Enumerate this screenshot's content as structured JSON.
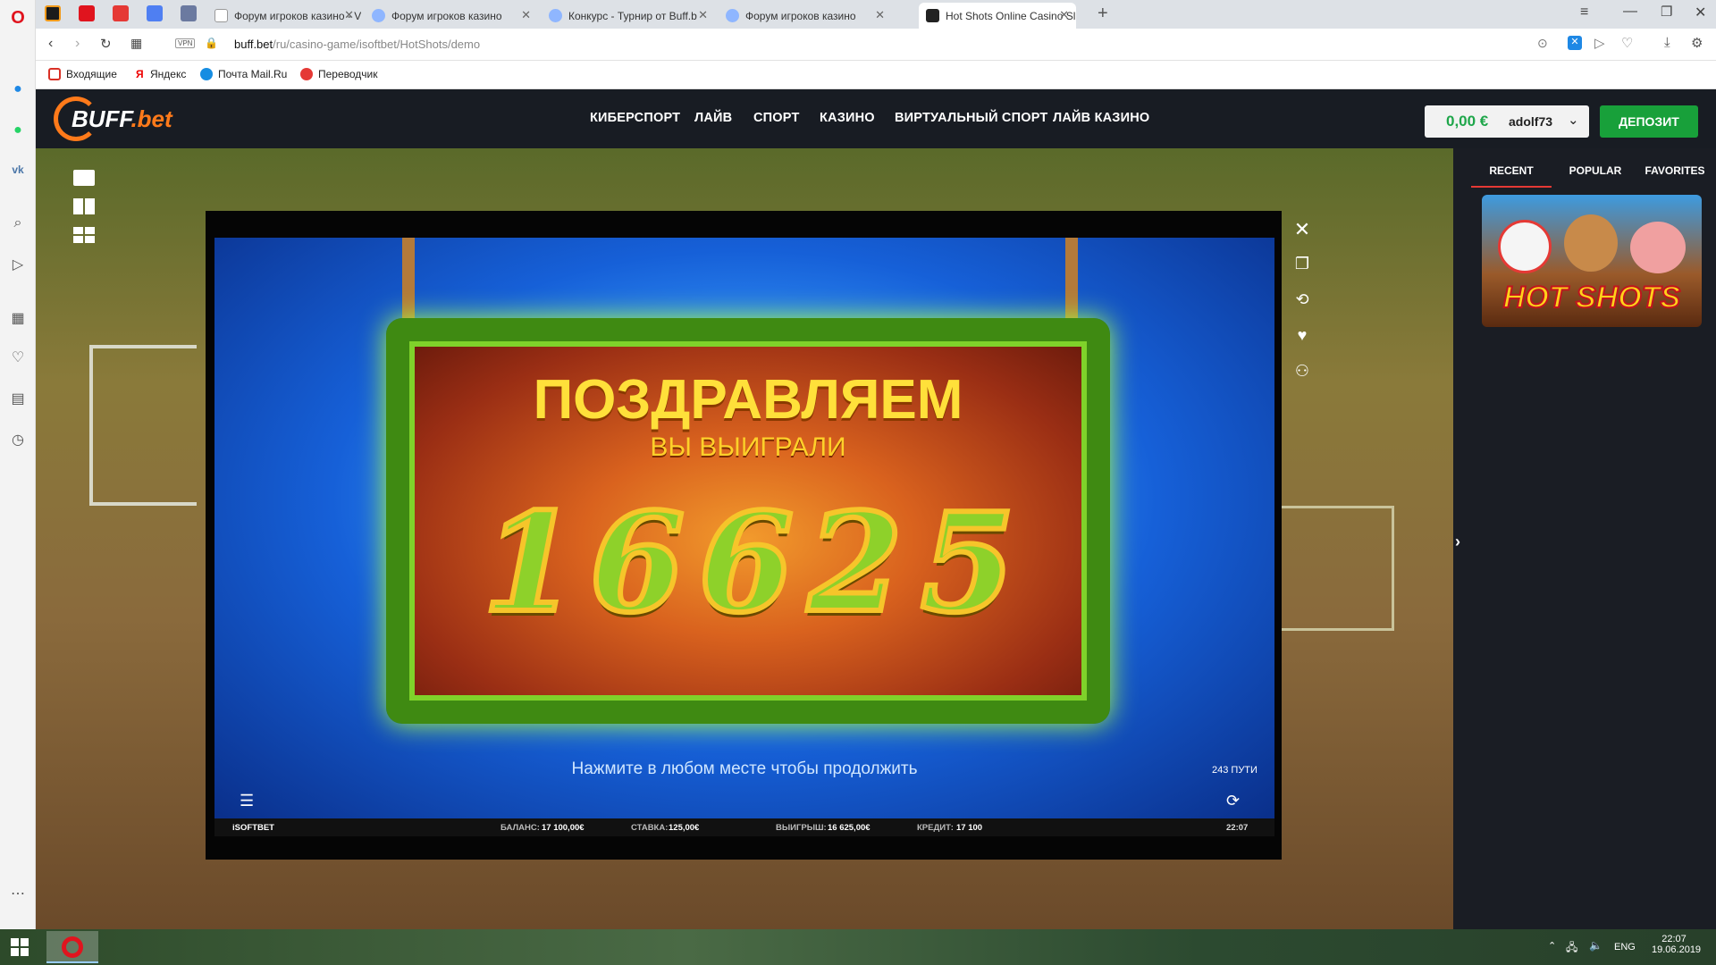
{
  "browser": {
    "tabs": [
      {
        "title": "Форум игроков казино - V"
      },
      {
        "title": "Форум игроков казино"
      },
      {
        "title": "Конкурс - Турнир от Buff.b"
      },
      {
        "title": "Форум игроков казино"
      },
      {
        "title": "Hot Shots Online Casino Sl"
      }
    ],
    "url_host": "buff.bet",
    "url_path": "/ru/casino-game/isoftbet/HotShots/demo",
    "vpn_label": "VPN",
    "bookmarks": [
      "Входящие",
      "Яндекс",
      "Почта Mail.Ru",
      "Переводчик"
    ]
  },
  "site": {
    "logo_main": "BUFF",
    "logo_suffix": ".bet",
    "nav": [
      "КИБЕРСПОРТ",
      "ЛАЙВ",
      "СПОРТ",
      "КАЗИНО",
      "ВИРТУАЛЬНЫЙ СПОРТ",
      "ЛАЙВ КАЗИНО"
    ],
    "balance": "0,00 €",
    "username": "adolf73",
    "deposit_label": "ДЕПОЗИТ"
  },
  "panel": {
    "tabs": [
      "RECENT",
      "POPULAR",
      "FAVORITES"
    ],
    "active_tab": "RECENT",
    "recent_game_title": "HOT SHOTS"
  },
  "game": {
    "headline": "ПОЗДРАВЛЯЕМ",
    "subhead": "ВЫ ВЫИГРАЛИ",
    "win_digits": [
      "1",
      "6",
      "6",
      "2",
      "5"
    ],
    "continue_hint": "Нажмите в любом месте чтобы продолжить",
    "ways": "243 ПУТИ",
    "provider": "iSOFTBET",
    "balance_label": "БАЛАНС:",
    "balance_value": "17 100,00€",
    "bet_label": "СТАВКА:",
    "bet_value": "125,00€",
    "win_label": "ВЫИГРЫШ:",
    "win_value": "16 625,00€",
    "credit_label": "КРЕДИТ:",
    "credit_value": "17 100",
    "clock": "22:07"
  },
  "taskbar": {
    "lang": "ENG",
    "time": "22:07",
    "date": "19.06.2019"
  }
}
